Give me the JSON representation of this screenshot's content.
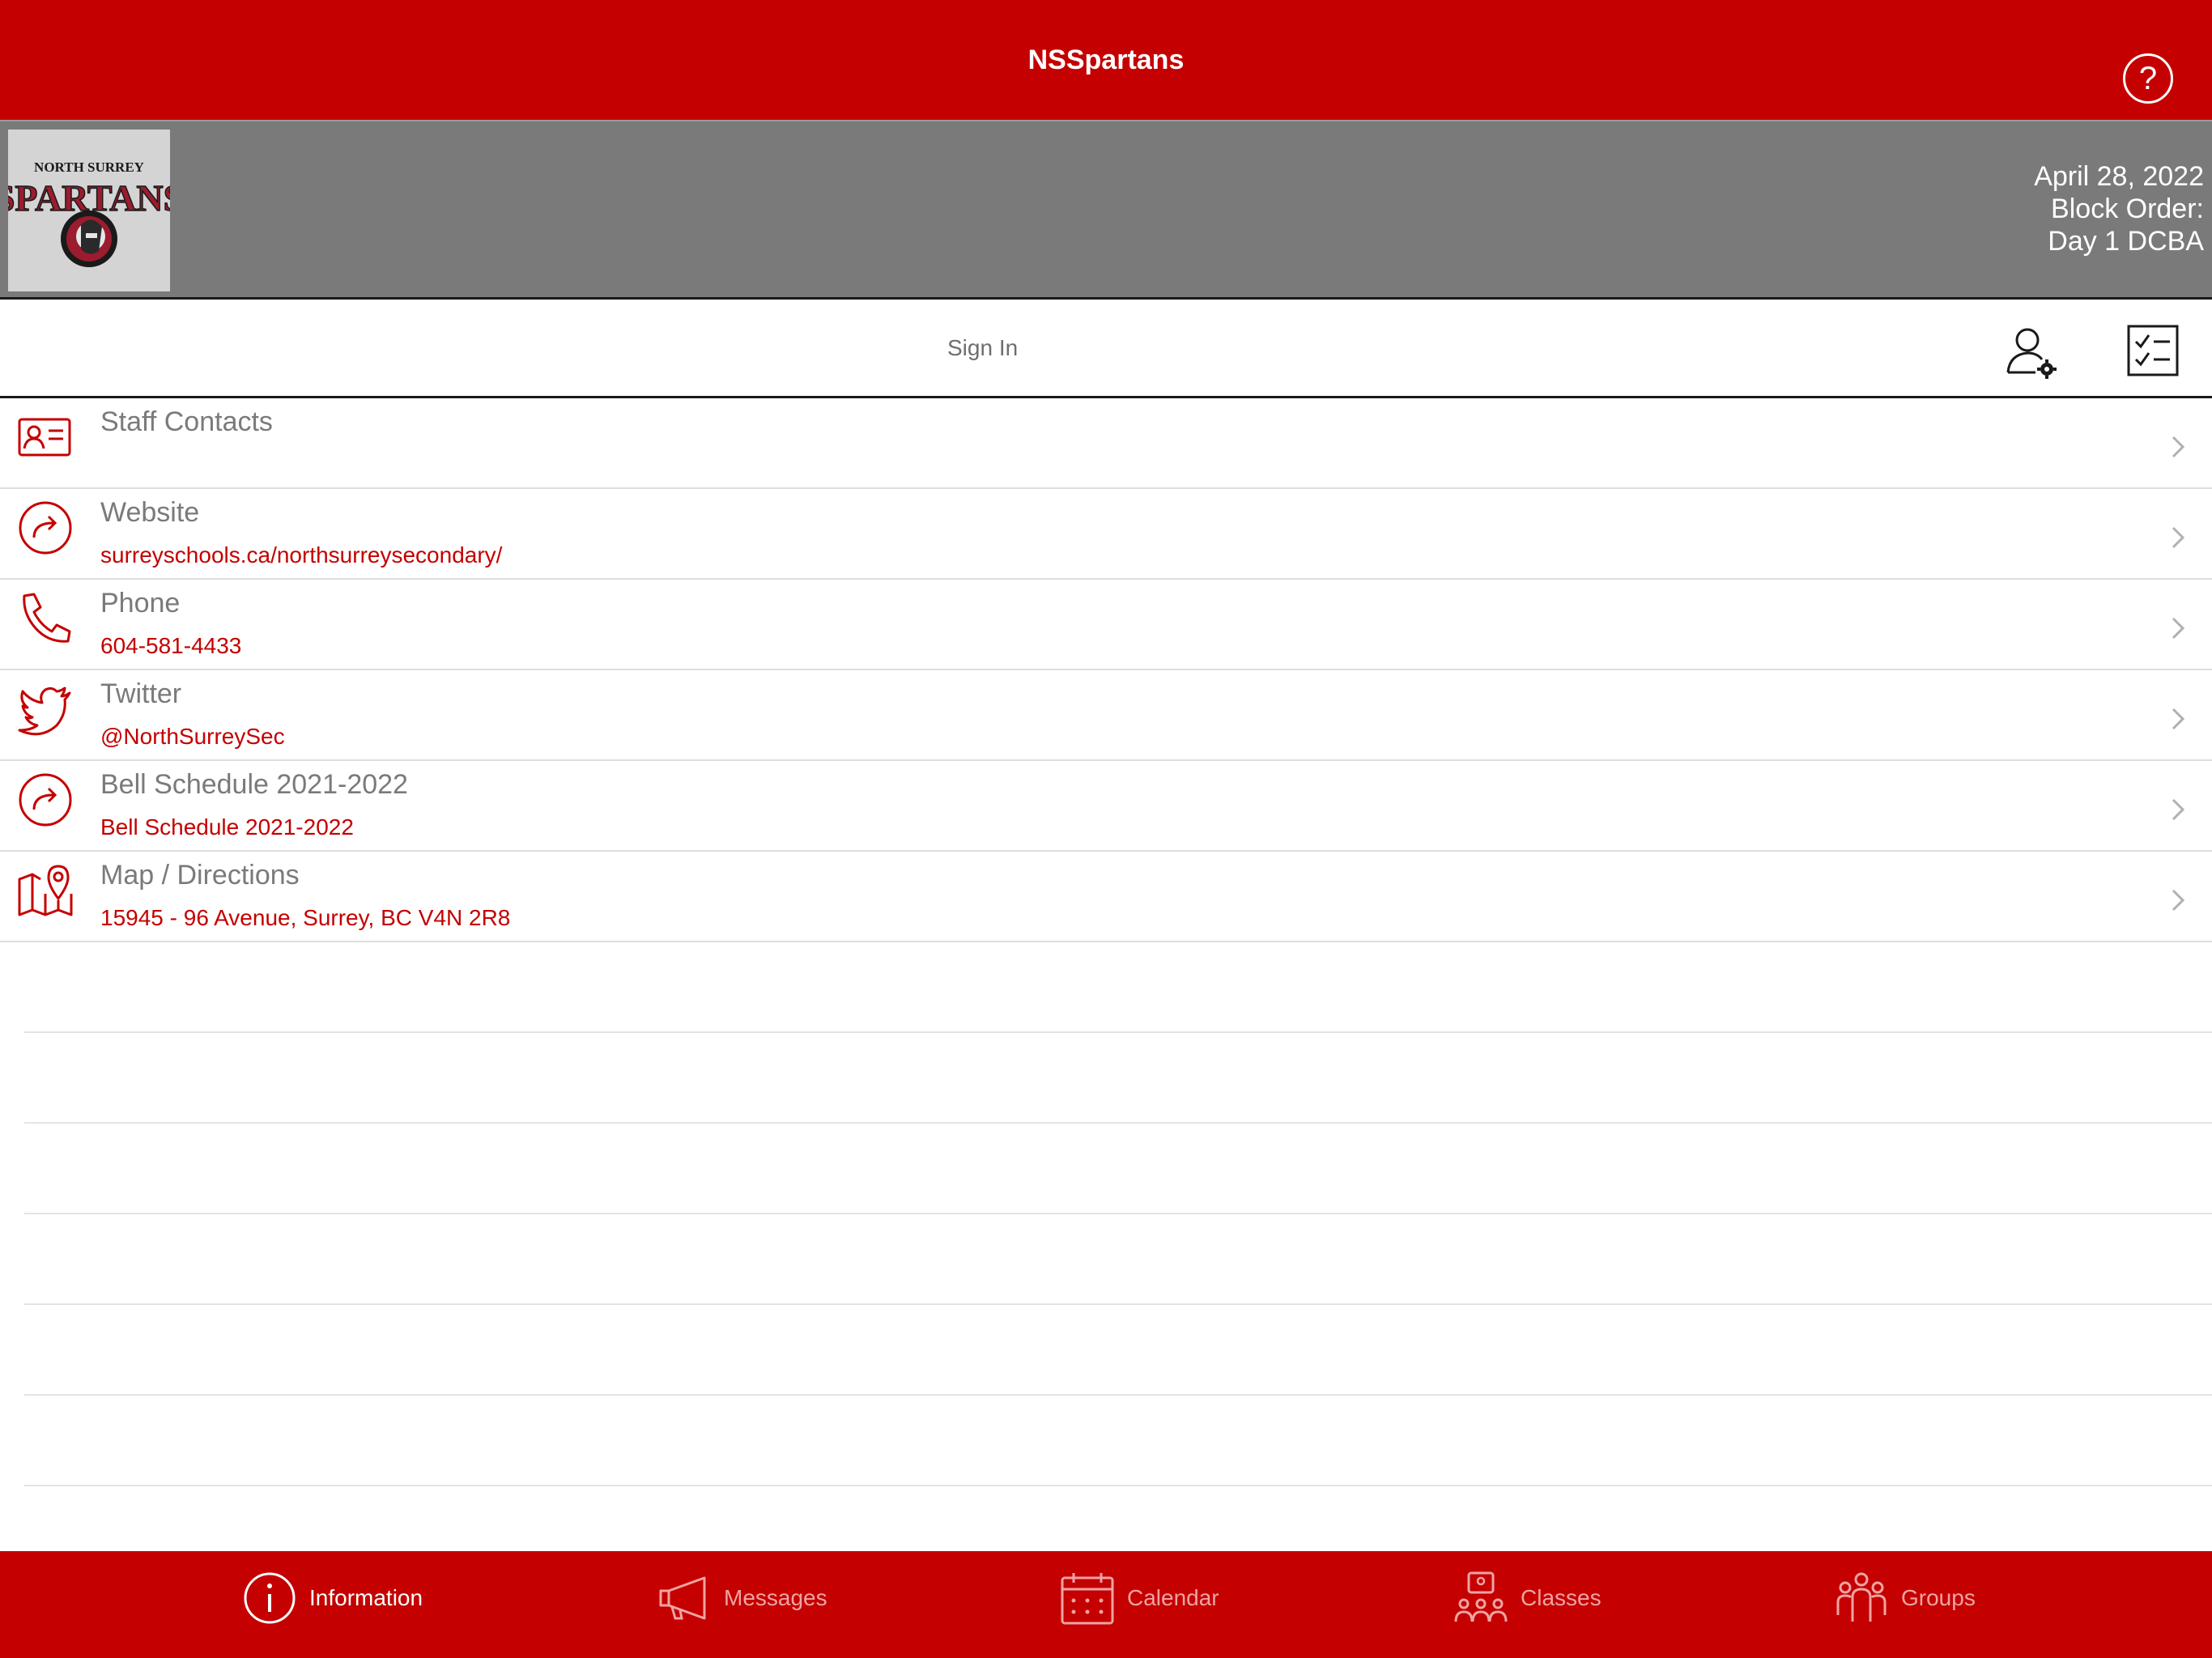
{
  "header": {
    "title": "NSSpartans",
    "help_icon": "question-circle-icon"
  },
  "banner": {
    "logo_text_top": "NORTH SURREY",
    "logo_text_main": "SPARTANS",
    "date": "April 28, 2022",
    "block_order_label": "Block Order:",
    "block_order_value": "Day 1 DCBA"
  },
  "signin": {
    "label": "Sign In",
    "account_icon": "user-gear-icon",
    "checklist_icon": "checklist-icon"
  },
  "list": [
    {
      "title": "Staff Contacts",
      "subtitle": "",
      "icon": "contact-card-icon"
    },
    {
      "title": "Website",
      "subtitle": "surreyschools.ca/northsurreysecondary/",
      "icon": "share-arrow-icon"
    },
    {
      "title": "Phone",
      "subtitle": "604-581-4433",
      "icon": "phone-icon"
    },
    {
      "title": "Twitter",
      "subtitle": "@NorthSurreySec",
      "icon": "twitter-bird-icon"
    },
    {
      "title": "Bell Schedule 2021-2022",
      "subtitle": "Bell Schedule 2021-2022",
      "icon": "share-arrow-icon"
    },
    {
      "title": "Map / Directions",
      "subtitle": "15945 - 96 Avenue, Surrey, BC V4N 2R8",
      "icon": "map-pin-icon"
    }
  ],
  "tabs": [
    {
      "label": "Information",
      "icon": "info-icon",
      "active": true
    },
    {
      "label": "Messages",
      "icon": "megaphone-icon",
      "active": false
    },
    {
      "label": "Calendar",
      "icon": "calendar-icon",
      "active": false
    },
    {
      "label": "Classes",
      "icon": "classroom-icon",
      "active": false
    },
    {
      "label": "Groups",
      "icon": "groups-icon",
      "active": false
    }
  ],
  "colors": {
    "brand_red": "#c40000",
    "banner_gray": "#7a7a7a",
    "title_gray": "#7a7a7a"
  }
}
